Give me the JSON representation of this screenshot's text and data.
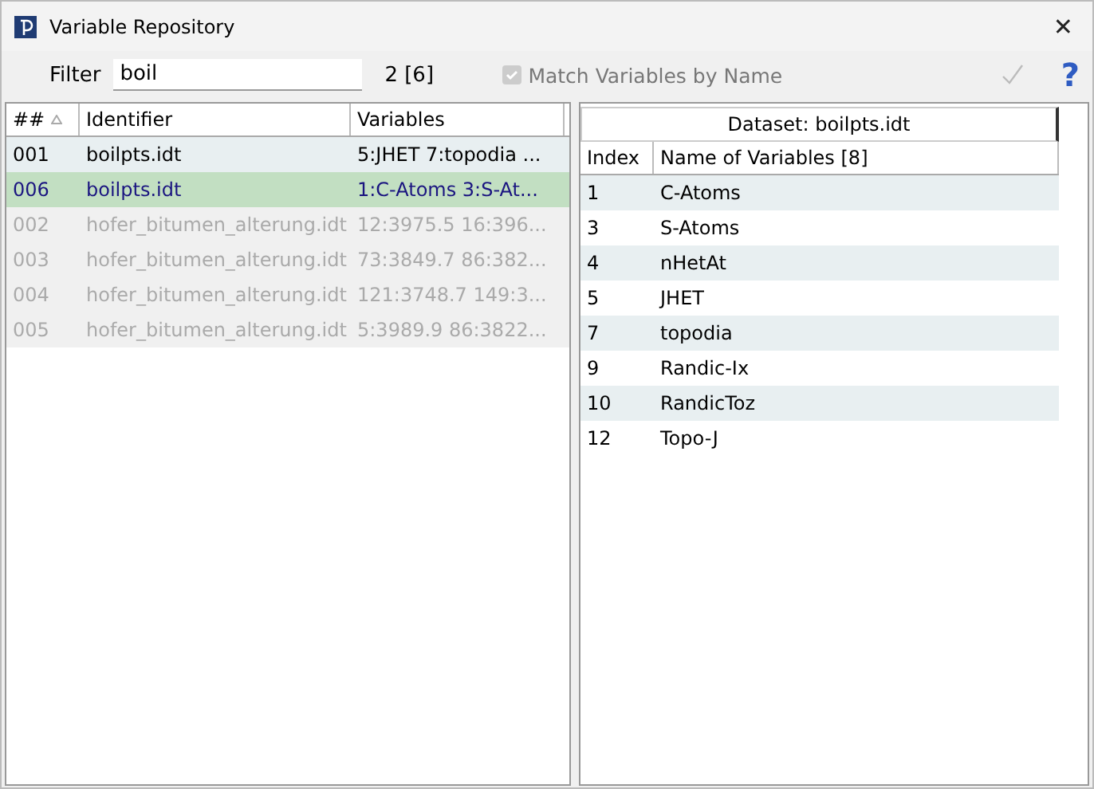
{
  "window": {
    "title": "Variable Repository",
    "close": "✕"
  },
  "filter": {
    "label": "Filter",
    "value": "boil",
    "count": "2 [6]",
    "match": {
      "label": "Match Variables by Name",
      "checked": true,
      "disabled": true
    },
    "help": "?"
  },
  "datasets": {
    "columns": [
      {
        "label": "##",
        "sorted": true
      },
      {
        "label": "Identifier",
        "sorted": false
      },
      {
        "label": "Variables",
        "sorted": false
      }
    ],
    "rows": [
      {
        "num": "001",
        "identifier": "boilpts.idt",
        "variables": "5:JHET 7:topodia ...",
        "selected": false,
        "disabled": false
      },
      {
        "num": "006",
        "identifier": "boilpts.idt",
        "variables": "1:C-Atoms 3:S-At...",
        "selected": true,
        "disabled": false
      },
      {
        "num": "002",
        "identifier": "hofer_bitumen_alterung.idt",
        "variables": "12:3975.5 16:396...",
        "selected": false,
        "disabled": true
      },
      {
        "num": "003",
        "identifier": "hofer_bitumen_alterung.idt",
        "variables": "73:3849.7 86:382...",
        "selected": false,
        "disabled": true
      },
      {
        "num": "004",
        "identifier": "hofer_bitumen_alterung.idt",
        "variables": "121:3748.7 149:3...",
        "selected": false,
        "disabled": true
      },
      {
        "num": "005",
        "identifier": "hofer_bitumen_alterung.idt",
        "variables": "5:3989.9 86:3822...",
        "selected": false,
        "disabled": true
      }
    ]
  },
  "variables": {
    "title": "Dataset: boilpts.idt",
    "columns": [
      "Index",
      "Name of Variables [8]"
    ],
    "rows": [
      {
        "index": "1",
        "name": "C-Atoms"
      },
      {
        "index": "3",
        "name": "S-Atoms"
      },
      {
        "index": "4",
        "name": "nHetAt"
      },
      {
        "index": "5",
        "name": "JHET"
      },
      {
        "index": "7",
        "name": "topodia"
      },
      {
        "index": "9",
        "name": "Randic-Ix"
      },
      {
        "index": "10",
        "name": "RandicToz"
      },
      {
        "index": "12",
        "name": "Topo-J"
      }
    ]
  }
}
